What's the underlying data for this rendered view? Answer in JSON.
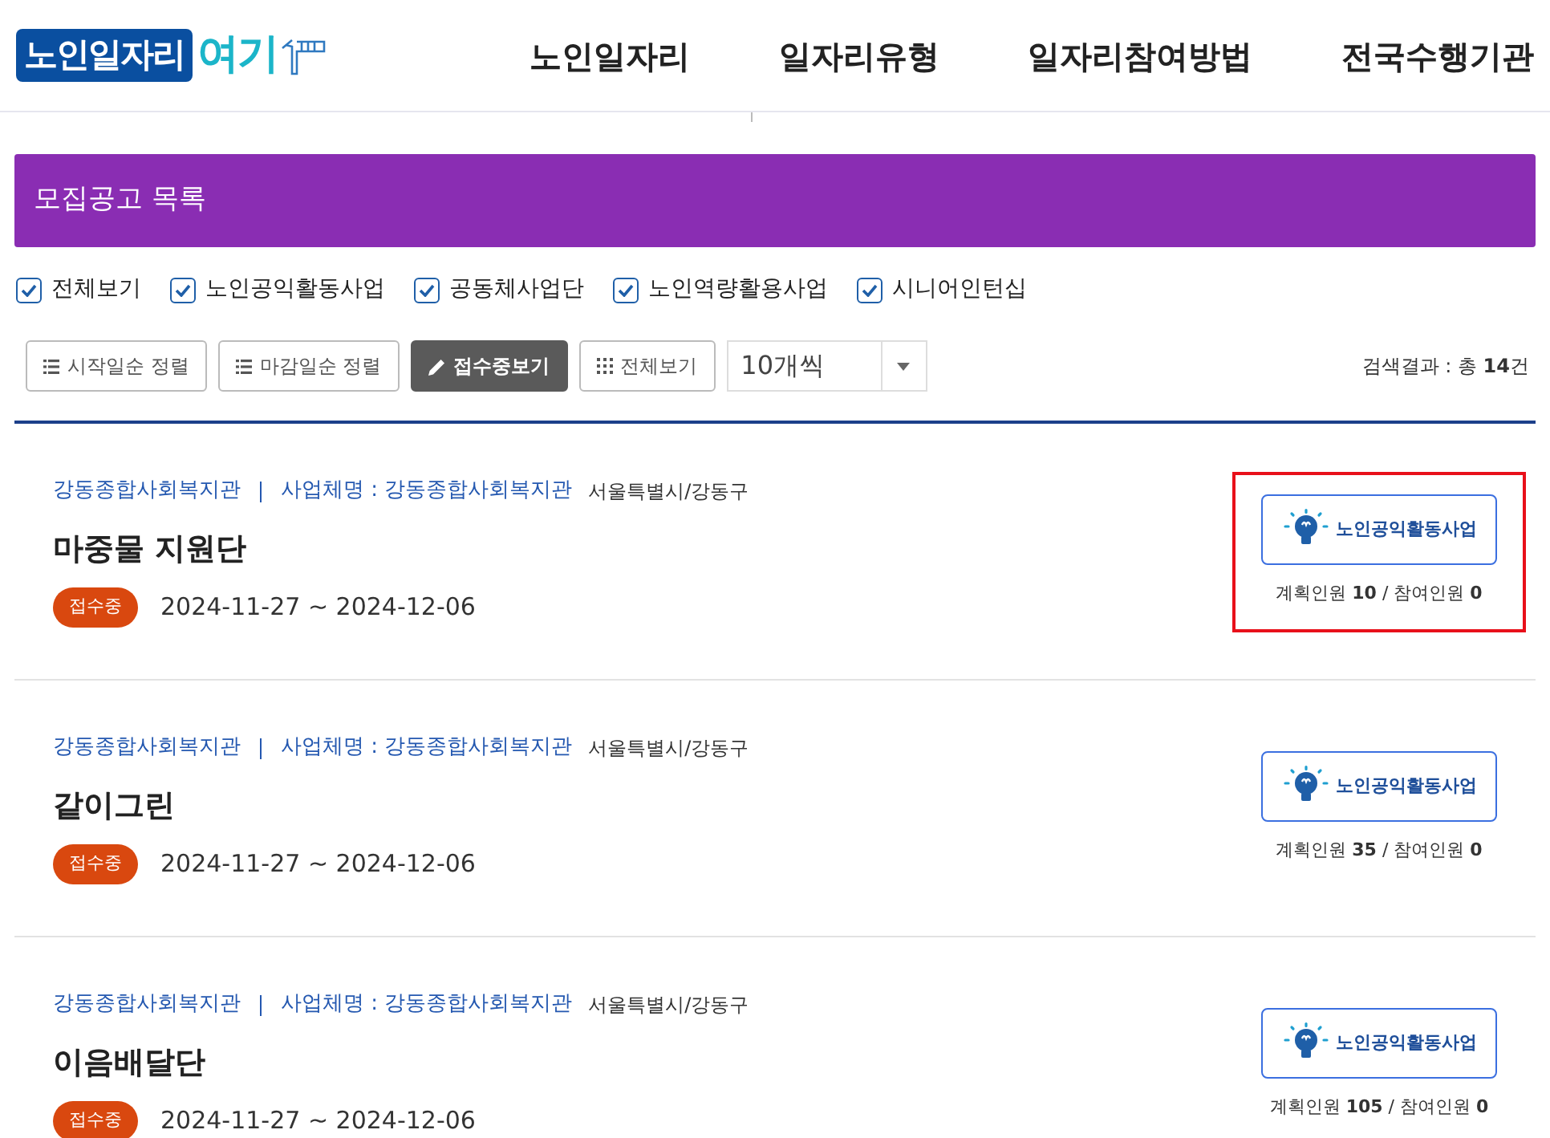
{
  "logo": {
    "main": "노인일자리",
    "accent": "여기"
  },
  "nav": [
    "노인일자리",
    "일자리유형",
    "일자리참여방법",
    "전국수행기관"
  ],
  "banner": {
    "title": "모집공고 목록"
  },
  "filters": [
    {
      "label": "전체보기",
      "checked": true
    },
    {
      "label": "노인공익활동사업",
      "checked": true
    },
    {
      "label": "공동체사업단",
      "checked": true
    },
    {
      "label": "노인역량활용사업",
      "checked": true
    },
    {
      "label": "시니어인턴십",
      "checked": true
    }
  ],
  "toolbar": {
    "buttons": [
      {
        "label": "시작일순 정렬",
        "kind": "list",
        "selected": false
      },
      {
        "label": "마감일순 정렬",
        "kind": "list",
        "selected": false
      },
      {
        "label": "접수중보기",
        "kind": "pencil",
        "selected": true
      },
      {
        "label": "전체보기",
        "kind": "grid",
        "selected": false
      }
    ],
    "page_size": "10개씩",
    "result": "검색결과 : 총 **14**건"
  },
  "listings": [
    {
      "org": "강동종합사회복지관",
      "business": "사업체명 : 강동종합사회복지관",
      "region": "서울특별시/강동구",
      "title": "마중물 지원단",
      "status": "접수중",
      "period": "2024-11-27 ~ 2024-12-06",
      "type": "노인공익활동사업",
      "counts": "계획인원 **10** / 참여인원 **0**",
      "highlighted": true
    },
    {
      "org": "강동종합사회복지관",
      "business": "사업체명 : 강동종합사회복지관",
      "region": "서울특별시/강동구",
      "title": "같이그린",
      "status": "접수중",
      "period": "2024-11-27 ~ 2024-12-06",
      "type": "노인공익활동사업",
      "counts": "계획인원 **35** / 참여인원 **0**",
      "highlighted": false
    },
    {
      "org": "강동종합사회복지관",
      "business": "사업체명 : 강동종합사회복지관",
      "region": "서울특별시/강동구",
      "title": "이음배달단",
      "status": "접수중",
      "period": "2024-11-27 ~ 2024-12-06",
      "type": "노인공익활동사업",
      "counts": "계획인원 **105** / 참여인원 **0**",
      "highlighted": false
    }
  ]
}
